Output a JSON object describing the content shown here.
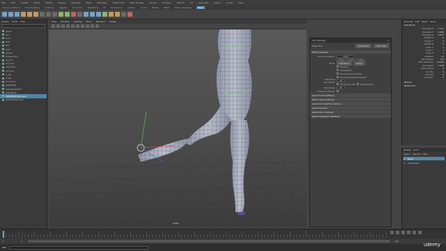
{
  "menubar": {
    "items": [
      "File",
      "Edit",
      "Create",
      "Select",
      "Modify",
      "Display",
      "Windows",
      "Mesh",
      "Edit Mesh",
      "Mesh Tools",
      "Mesh Display",
      "Curves",
      "Surfaces",
      "Deform",
      "UV",
      "Generate",
      "Cache",
      "Arnold",
      "Help"
    ],
    "mode": "Modeling",
    "workspace": "Maya Classic"
  },
  "shelf": {
    "tabs": [
      "Curves / Surfaces",
      "Poly Modeling",
      "Sculpting",
      "Rigging",
      "Animation",
      "Rendering",
      "FX",
      "FX Caching",
      "Custom",
      "Arnold",
      "Bifrost",
      "MASH",
      "Motion Graphics",
      "XGen"
    ],
    "active": "XGen"
  },
  "outliner": {
    "menu": [
      "Display",
      "Show",
      "Help"
    ],
    "items": [
      "persp",
      "top",
      "front",
      "side",
      "left",
      "back",
      "pCube",
      "polySurface",
      "hip_jnt",
      "ctrl_hips",
      "ctrl_hand",
      "ctrl_foot",
      "L_leg",
      "R_leg",
      "ctrl_arms",
      "defaultSet",
      "defaultLightSet",
      "bikiniMesh",
      "defaultRenderLayer",
      "defaultObjectSet"
    ],
    "selected_index": 18
  },
  "viewport": {
    "menu": [
      "View",
      "Shading",
      "Lighting",
      "Show",
      "Renderer",
      "Panels"
    ],
    "camera_label": "persp"
  },
  "tool_settings": {
    "title": "Tool Settings",
    "tool_name": "Move Tool",
    "reset_label": "Reset Tool",
    "help_label": "Tool Help",
    "section": "Move Settings",
    "axis_orientation_label": "Axis Orientation:",
    "axis_orientation_value": "Object",
    "values": [
      "0.0000",
      "0.0000",
      "0.0000"
    ],
    "pivot_label": "Pivot:",
    "edit_pivot": "Edit Pivot",
    "reset": "Reset",
    "pin_options": [
      "Position",
      "Orientation",
      "Pin Component Pivot",
      "Show Orientation Handle"
    ],
    "transform_constraint_label": "Transform Constraint:",
    "transform_constraint_value": "Off",
    "along_normals": "Along Normals",
    "closest_point": "Closest Point",
    "step_snap_label": "Step Snap:",
    "step_snap_value": "Off",
    "preserve_label": "Preserve Children",
    "collapsed": [
      "Joint Orient Settings",
      "Move Snap Settings",
      "Common Selection Options",
      "Soft Selection",
      "Symmetry Settings",
      "Reset Displayed Settings"
    ]
  },
  "channel_box": {
    "menu": [
      "Channels",
      "Edit",
      "Object",
      "Show"
    ],
    "object": "bikiniBod1",
    "rows": [
      {
        "name": "Translate X",
        "value": "-7.711"
      },
      {
        "name": "Translate Y",
        "value": "5.099"
      },
      {
        "name": "Translate Z",
        "value": "0.227"
      },
      {
        "name": "Rotate X",
        "value": "0"
      },
      {
        "name": "Rotate Y",
        "value": "0"
      },
      {
        "name": "Rotate Z",
        "value": "0"
      },
      {
        "name": "Scale X",
        "value": "1"
      },
      {
        "name": "Scale Y",
        "value": "1"
      },
      {
        "name": "Scale Z",
        "value": "1"
      },
      {
        "name": "Visibility",
        "value": "on"
      },
      {
        "name": "Max Radius",
        "value": "0.5"
      },
      {
        "name": "Max Iterations",
        "value": "1.2000"
      },
      {
        "name": "Ray Depth",
        "value": "1.058"
      },
      {
        "name": "Start Frame",
        "value": "0"
      },
      {
        "name": "Gravity",
        "value": "0"
      },
      {
        "name": "Shadow",
        "value": "0"
      },
      {
        "name": "Dynamic",
        "value": "0"
      }
    ],
    "inputs_label": "INPUTS",
    "inputs_item": "Bk|Position"
  },
  "layers": {
    "menu": [
      "Display",
      "Anim"
    ],
    "submenu": [
      "Layers",
      "Options",
      "Help"
    ],
    "items": [
      {
        "name": "Bikini",
        "sel": true
      },
      {
        "name": "Underwear",
        "sel": false
      }
    ]
  },
  "timeline": {
    "start": "1",
    "end": "120",
    "current": "1"
  },
  "command_line": {
    "label": "MEL",
    "watermark": "udemy"
  }
}
